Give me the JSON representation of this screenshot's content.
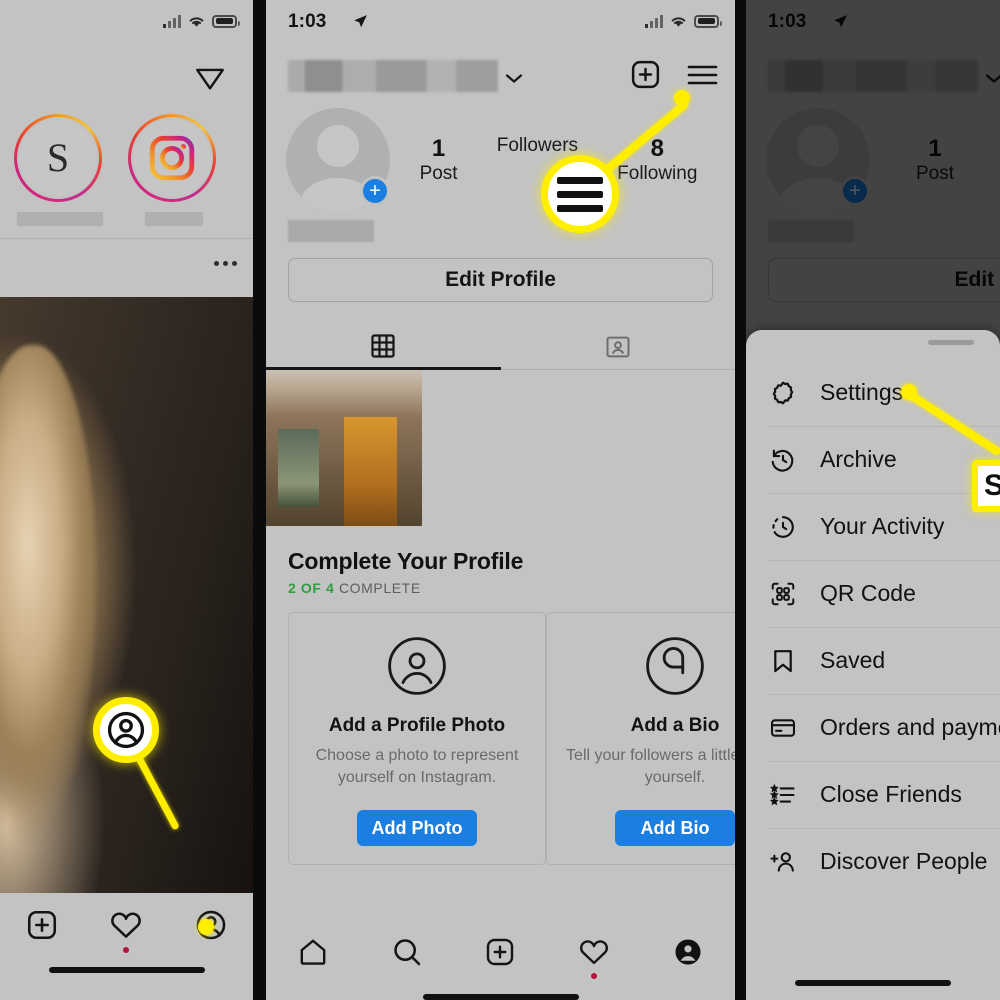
{
  "meta": {
    "bg": "#c3c3c3",
    "accent_yellow": "#ffee00",
    "link_blue": "#1a7fe0",
    "green": "#2f9e3f"
  },
  "status_bar": {
    "time": "1:03",
    "location_icon": "location-arrow-icon",
    "wifi_icon": "wifi-icon",
    "cellular_icon": "cellular-bars-icon",
    "battery_icon": "battery-icon"
  },
  "panel1": {
    "name": "instagram-feed-screen",
    "header": {
      "share_icon": "direct-message-send-icon"
    },
    "stories": [
      {
        "label_redacted": true,
        "glyph": "S",
        "name": "story-ring-s-logo"
      },
      {
        "label_redacted": true,
        "glyph": "instagram-logo",
        "name": "story-ring-instagram-logo"
      }
    ],
    "post": {
      "more_icon": "more-options-icon",
      "image_alt": "dog-on-dark-fabric-photo"
    },
    "tabbar": [
      {
        "icon": "plus-square-icon",
        "label": "Create",
        "active": false,
        "badge": false
      },
      {
        "icon": "heart-icon",
        "label": "Activity",
        "active": false,
        "badge": true
      },
      {
        "icon": "profile-circle-icon",
        "label": "Profile",
        "active": false,
        "badge": false
      }
    ],
    "callout": {
      "icon": "profile-circle-icon",
      "target": "profile-tab"
    }
  },
  "panel2": {
    "name": "instagram-profile-screen",
    "header": {
      "username_redacted": true,
      "chevron_icon": "chevron-down-icon",
      "add_icon": "plus-square-icon",
      "menu_icon": "hamburger-menu-icon"
    },
    "avatar": {
      "placeholder": true,
      "add_badge": "+"
    },
    "stats": [
      {
        "num": "1",
        "label": "Post"
      },
      {
        "num": "",
        "label": "Followers"
      },
      {
        "num": "8",
        "label": "Following"
      }
    ],
    "bio_redacted": true,
    "edit_profile_label": "Edit Profile",
    "tabs": [
      {
        "icon": "grid-icon",
        "name": "tab-grid",
        "active": true
      },
      {
        "icon": "tagged-person-icon",
        "name": "tab-tagged",
        "active": false
      }
    ],
    "post_thumb_alt": "schnitzstube-storefront-photo",
    "complete": {
      "title": "Complete Your Profile",
      "progress_done": "2",
      "progress_of": "OF",
      "progress_total": "4",
      "progress_word": "COMPLETE",
      "cards": [
        {
          "icon": "profile-circle-outline-icon",
          "title": "Add a Profile Photo",
          "desc": "Choose a photo to represent yourself on Instagram.",
          "button": "Add Photo"
        },
        {
          "icon": "bio-speech-bubble-icon",
          "title": "Add a Bio",
          "desc": "Tell your followers a little about yourself.",
          "button": "Add Bio"
        }
      ]
    },
    "tabbar": [
      {
        "icon": "home-icon",
        "label": "Home",
        "active": false,
        "badge": false
      },
      {
        "icon": "search-icon",
        "label": "Search",
        "active": false,
        "badge": false
      },
      {
        "icon": "plus-square-icon",
        "label": "Create",
        "active": false,
        "badge": false
      },
      {
        "icon": "heart-icon",
        "label": "Activity",
        "active": false,
        "badge": true
      },
      {
        "icon": "profile-circle-filled-icon",
        "label": "Profile",
        "active": true,
        "badge": false
      }
    ],
    "callout": {
      "icon": "hamburger-menu-icon",
      "target": "hamburger-menu-button"
    }
  },
  "panel3": {
    "name": "instagram-side-menu-screen",
    "dimmed_background": true,
    "background_profile": {
      "stats": [
        {
          "num": "1",
          "label": "Post"
        }
      ],
      "edit_profile_label": "Edit Pro",
      "chevron_icon": "chevron-down-icon",
      "add_badge": "+"
    },
    "sheet": {
      "grabber": true,
      "items": [
        {
          "icon": "gear-icon",
          "label": "Settings"
        },
        {
          "icon": "archive-clock-icon",
          "label": "Archive"
        },
        {
          "icon": "activity-clock-icon",
          "label": "Your Activity"
        },
        {
          "icon": "qr-code-icon",
          "label": "QR Code"
        },
        {
          "icon": "bookmark-icon",
          "label": "Saved"
        },
        {
          "icon": "credit-card-icon",
          "label": "Orders and payments"
        },
        {
          "icon": "close-friends-icon",
          "label": "Close Friends"
        },
        {
          "icon": "add-person-icon",
          "label": "Discover People"
        }
      ]
    },
    "callout": {
      "label": "S",
      "target": "settings-menu-item"
    }
  }
}
